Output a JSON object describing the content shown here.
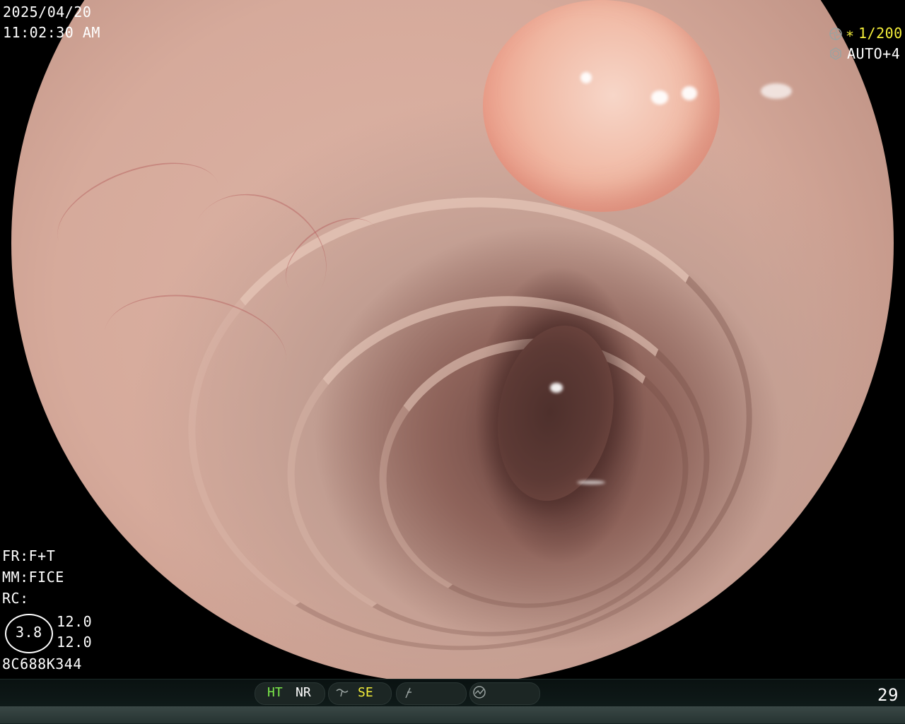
{
  "overlay": {
    "date": "2025/04/20",
    "time": "11:02:30  AM",
    "shutter": "1/200",
    "shutter_prefix": "∗",
    "exposure": "AUTO+4",
    "fr": "FR:F+T",
    "mm": "MM:FICE",
    "rc": "RC:",
    "circle_value": "3.8",
    "value_top": "12.0",
    "value_bottom": "12.0",
    "serial": "8C688K344"
  },
  "statusbar": {
    "ht": "HT",
    "nr": "NR",
    "se": "SE",
    "frame": "29"
  },
  "colors": {
    "yellow": "#f5ef3a",
    "green": "#7be84a",
    "white": "#ffffff",
    "icon_gray": "#9aa3a1"
  },
  "icons": {
    "shutter": "aperture-icon",
    "exposure": "iris-icon",
    "enhance": "wave-icon",
    "flash": "slash-icon",
    "mode": "gauge-icon"
  }
}
